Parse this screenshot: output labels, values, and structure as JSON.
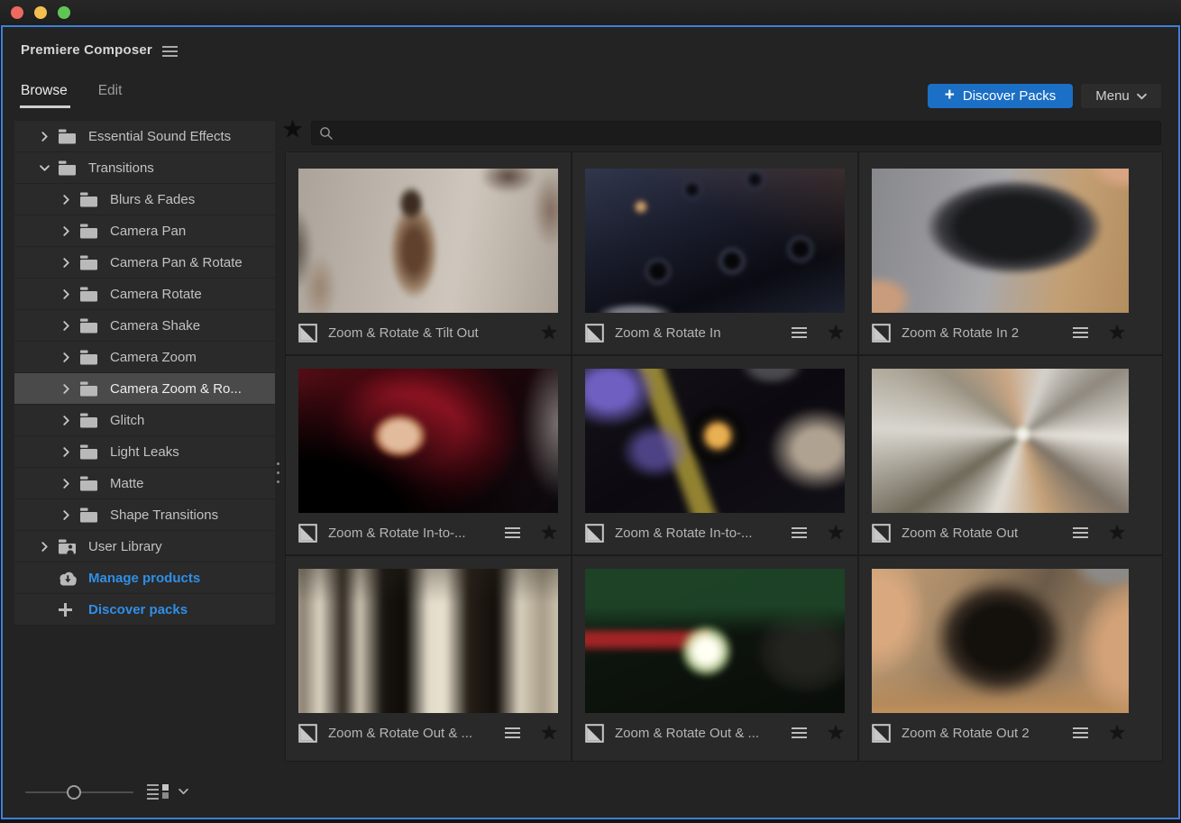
{
  "window": {
    "title": "Premiere Composer"
  },
  "tabs": [
    {
      "label": "Browse",
      "active": true
    },
    {
      "label": "Edit",
      "active": false
    }
  ],
  "header": {
    "discover_packs_label": "Discover Packs",
    "menu_label": "Menu"
  },
  "search": {
    "value": "",
    "placeholder": ""
  },
  "glyphs": {
    "star": "★",
    "plus": "+"
  },
  "sidebar": {
    "items": [
      {
        "label": "Essential Sound Effects",
        "level": 0,
        "chevron": "right",
        "icon": "folder",
        "selected": false,
        "link": false
      },
      {
        "label": "Transitions",
        "level": 0,
        "chevron": "down",
        "icon": "folder",
        "selected": false,
        "link": false
      },
      {
        "label": "Blurs & Fades",
        "level": 1,
        "chevron": "right",
        "icon": "folder",
        "selected": false,
        "link": false
      },
      {
        "label": "Camera Pan",
        "level": 1,
        "chevron": "right",
        "icon": "folder",
        "selected": false,
        "link": false
      },
      {
        "label": "Camera Pan & Rotate",
        "level": 1,
        "chevron": "right",
        "icon": "folder",
        "selected": false,
        "link": false
      },
      {
        "label": "Camera Rotate",
        "level": 1,
        "chevron": "right",
        "icon": "folder",
        "selected": false,
        "link": false
      },
      {
        "label": "Camera Shake",
        "level": 1,
        "chevron": "right",
        "icon": "folder",
        "selected": false,
        "link": false
      },
      {
        "label": "Camera Zoom",
        "level": 1,
        "chevron": "right",
        "icon": "folder",
        "selected": false,
        "link": false
      },
      {
        "label": "Camera Zoom & Ro...",
        "level": 1,
        "chevron": "right",
        "icon": "folder",
        "selected": true,
        "link": false
      },
      {
        "label": "Glitch",
        "level": 1,
        "chevron": "right",
        "icon": "folder",
        "selected": false,
        "link": false
      },
      {
        "label": "Light Leaks",
        "level": 1,
        "chevron": "right",
        "icon": "folder",
        "selected": false,
        "link": false
      },
      {
        "label": "Matte",
        "level": 1,
        "chevron": "right",
        "icon": "folder",
        "selected": false,
        "link": false
      },
      {
        "label": "Shape Transitions",
        "level": 1,
        "chevron": "right",
        "icon": "folder",
        "selected": false,
        "link": false
      },
      {
        "label": "User Library",
        "level": 0,
        "chevron": "right",
        "icon": "user-library",
        "selected": false,
        "link": false
      },
      {
        "label": "Manage products",
        "level": 0,
        "chevron": null,
        "icon": "cloud-download",
        "selected": false,
        "link": true
      },
      {
        "label": "Discover packs",
        "level": 0,
        "chevron": null,
        "icon": "plus",
        "selected": false,
        "link": true
      }
    ]
  },
  "grid": {
    "items": [
      {
        "label": "Zoom & Rotate & Tilt Out",
        "menu": false,
        "favorited": false,
        "thumb": "t1"
      },
      {
        "label": "Zoom & Rotate In",
        "menu": true,
        "favorited": false,
        "thumb": "t2"
      },
      {
        "label": "Zoom & Rotate In 2",
        "menu": true,
        "favorited": false,
        "thumb": "t3"
      },
      {
        "label": "Zoom & Rotate In-to-...",
        "menu": true,
        "favorited": false,
        "thumb": "t4"
      },
      {
        "label": "Zoom & Rotate In-to-...",
        "menu": true,
        "favorited": false,
        "thumb": "t5"
      },
      {
        "label": "Zoom & Rotate Out",
        "menu": true,
        "favorited": false,
        "thumb": "t6"
      },
      {
        "label": "Zoom & Rotate Out & ...",
        "menu": true,
        "favorited": false,
        "thumb": "t7"
      },
      {
        "label": "Zoom & Rotate Out & ...",
        "menu": true,
        "favorited": false,
        "thumb": "t8"
      },
      {
        "label": "Zoom & Rotate Out 2",
        "menu": true,
        "favorited": false,
        "thumb": "t9"
      }
    ]
  },
  "colors": {
    "accent_blue": "#1b6fc4",
    "link_blue": "#2f8fe8",
    "focus_ring": "#3f7fd6",
    "panel_bg": "#232323",
    "row_bg": "#2a2a2a",
    "selected_row_bg": "#4a4a4a",
    "cell_bg": "#292929",
    "traffic_red": "#ec6a5e",
    "traffic_yellow": "#f4bf4f",
    "traffic_green": "#61c554"
  }
}
